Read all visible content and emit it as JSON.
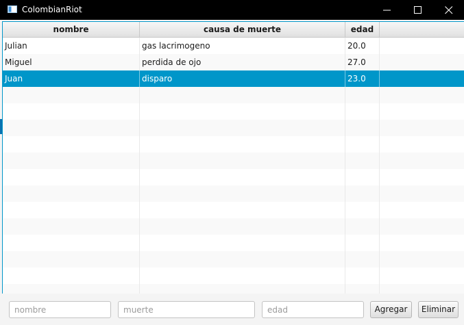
{
  "window": {
    "title": "ColombianRiot",
    "icons": {
      "app": "window-icon",
      "minimize": "minimize-icon",
      "maximize": "maximize-icon",
      "close": "close-icon"
    }
  },
  "table": {
    "columns": [
      "nombre",
      "causa de muerte",
      "edad",
      ""
    ],
    "rows": [
      {
        "nombre": "Julian",
        "causa": "gas lacrimogeno",
        "edad": "20.0",
        "selected": false
      },
      {
        "nombre": "Miguel",
        "causa": "perdida de ojo",
        "edad": "27.0",
        "selected": false
      },
      {
        "nombre": "Juan",
        "causa": "disparo",
        "edad": "23.0",
        "selected": true
      }
    ],
    "selection_color": "#0096c9"
  },
  "form": {
    "nombre": {
      "value": "",
      "placeholder": "nombre"
    },
    "muerte": {
      "value": "",
      "placeholder": "muerte"
    },
    "edad": {
      "value": "",
      "placeholder": "edad"
    },
    "add_label": "Agregar",
    "delete_label": "Eliminar"
  }
}
